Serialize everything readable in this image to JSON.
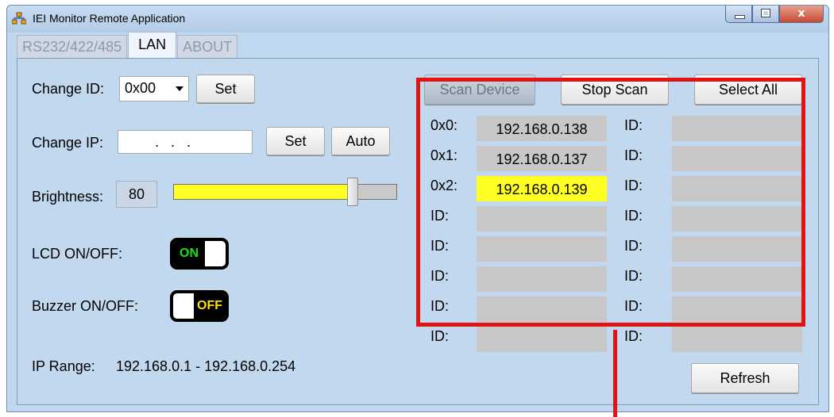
{
  "window": {
    "title": "IEI Monitor Remote Application"
  },
  "tabs": [
    {
      "label": "RS232/422/485",
      "active": false
    },
    {
      "label": "LAN",
      "active": true
    },
    {
      "label": "ABOUT",
      "active": false
    }
  ],
  "left": {
    "change_id_label": "Change ID:",
    "change_id_value": "0x00",
    "change_id_set": "Set",
    "change_ip_label": "Change IP:",
    "change_ip_value": ".   .   .",
    "change_ip_set": "Set",
    "change_ip_auto": "Auto",
    "brightness_label": "Brightness:",
    "brightness_value": "80",
    "brightness_level_fraction": 0.8,
    "lcd_label": "LCD ON/OFF:",
    "lcd_state": "ON",
    "buzzer_label": "Buzzer ON/OFF:",
    "buzzer_state": "OFF",
    "ip_range_label": "IP Range:",
    "ip_range_value": "192.168.0.1 - 192.168.0.254"
  },
  "right": {
    "scan_device": "Scan Device",
    "stop_scan": "Stop Scan",
    "select_all": "Select All",
    "refresh": "Refresh",
    "devices_col1": [
      {
        "id": "0x0:",
        "ip": "192.168.0.138",
        "selected": false
      },
      {
        "id": "0x1:",
        "ip": "192.168.0.137",
        "selected": false
      },
      {
        "id": "0x2:",
        "ip": "192.168.0.139",
        "selected": true
      },
      {
        "id": "ID:",
        "ip": "",
        "selected": false
      },
      {
        "id": "ID:",
        "ip": "",
        "selected": false
      },
      {
        "id": "ID:",
        "ip": "",
        "selected": false
      },
      {
        "id": "ID:",
        "ip": "",
        "selected": false
      },
      {
        "id": "ID:",
        "ip": "",
        "selected": false
      }
    ],
    "devices_col2": [
      {
        "id": "ID:",
        "ip": ""
      },
      {
        "id": "ID:",
        "ip": ""
      },
      {
        "id": "ID:",
        "ip": ""
      },
      {
        "id": "ID:",
        "ip": ""
      },
      {
        "id": "ID:",
        "ip": ""
      },
      {
        "id": "ID:",
        "ip": ""
      },
      {
        "id": "ID:",
        "ip": ""
      },
      {
        "id": "ID:",
        "ip": ""
      }
    ]
  },
  "colors": {
    "highlight_selected": "#ffff24",
    "slider_fill": "#ffff26",
    "on_text": "#18e018",
    "off_text": "#ffe000",
    "annotation_red": "#e01414"
  },
  "icons": {
    "app": "app-network-icon",
    "minimize": "minimize-icon",
    "maximize": "maximize-icon",
    "close": "close-icon",
    "dropdown": "chevron-down-icon"
  }
}
